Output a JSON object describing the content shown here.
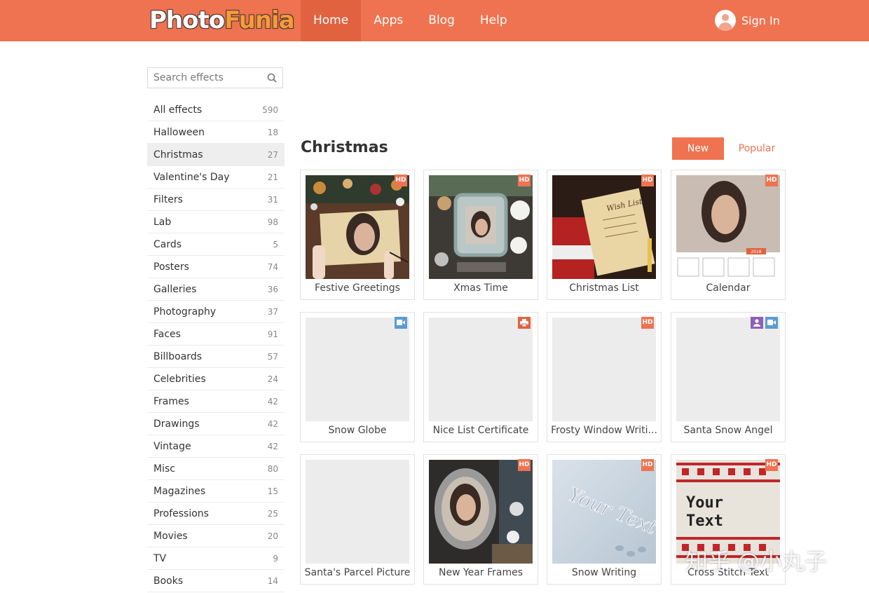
{
  "header": {
    "logo_part1": "Photo",
    "logo_part2": "Funia",
    "nav": [
      "Home",
      "Apps",
      "Blog",
      "Help"
    ],
    "active_nav": "Home",
    "sign_in": "Sign In"
  },
  "sidebar": {
    "search_placeholder": "Search effects",
    "categories": [
      {
        "label": "All effects",
        "count": "590"
      },
      {
        "label": "Halloween",
        "count": "18"
      },
      {
        "label": "Christmas",
        "count": "27"
      },
      {
        "label": "Valentine's Day",
        "count": "21"
      },
      {
        "label": "Filters",
        "count": "31"
      },
      {
        "label": "Lab",
        "count": "98"
      },
      {
        "label": "Cards",
        "count": "5"
      },
      {
        "label": "Posters",
        "count": "74"
      },
      {
        "label": "Galleries",
        "count": "36"
      },
      {
        "label": "Photography",
        "count": "37"
      },
      {
        "label": "Faces",
        "count": "91"
      },
      {
        "label": "Billboards",
        "count": "57"
      },
      {
        "label": "Celebrities",
        "count": "24"
      },
      {
        "label": "Frames",
        "count": "42"
      },
      {
        "label": "Drawings",
        "count": "42"
      },
      {
        "label": "Vintage",
        "count": "42"
      },
      {
        "label": "Misc",
        "count": "80"
      },
      {
        "label": "Magazines",
        "count": "15"
      },
      {
        "label": "Professions",
        "count": "25"
      },
      {
        "label": "Movies",
        "count": "20"
      },
      {
        "label": "TV",
        "count": "9"
      },
      {
        "label": "Books",
        "count": "14"
      }
    ],
    "active_category": "Christmas"
  },
  "main": {
    "title": "Christmas",
    "sort_new": "New",
    "sort_popular": "Popular",
    "effects": [
      {
        "label": "Festive Greetings",
        "badges": [
          "HD"
        ],
        "thumb": "festive-greetings"
      },
      {
        "label": "Xmas Time",
        "badges": [
          "HD"
        ],
        "thumb": "xmas-time"
      },
      {
        "label": "Christmas List",
        "badges": [
          "HD"
        ],
        "thumb": "christmas-list"
      },
      {
        "label": "Calendar",
        "badges": [
          "HD"
        ],
        "thumb": "calendar"
      },
      {
        "label": "Snow Globe",
        "badges": [
          "video"
        ],
        "thumb": "blank"
      },
      {
        "label": "Nice List Certificate",
        "badges": [
          "print"
        ],
        "thumb": "blank"
      },
      {
        "label": "Frosty Window Writi...",
        "badges": [
          "HD"
        ],
        "thumb": "blank"
      },
      {
        "label": "Santa Snow Angel",
        "badges": [
          "person",
          "video"
        ],
        "thumb": "blank"
      },
      {
        "label": "Santa's Parcel Picture",
        "badges": [],
        "thumb": "blank"
      },
      {
        "label": "New Year Frames",
        "badges": [
          "HD"
        ],
        "thumb": "new-year-frames"
      },
      {
        "label": "Snow Writing",
        "badges": [
          "HD"
        ],
        "thumb": "snow-writing"
      },
      {
        "label": "Cross Stitch Text",
        "badges": [
          "HD"
        ],
        "thumb": "cross-stitch"
      }
    ],
    "thumb_texts": {
      "wish_list": "Wish List",
      "calendar_year": "2018",
      "snow_text": "Your Text",
      "stitch_line1": "Your",
      "stitch_line2": "Text"
    }
  },
  "watermark": "知乎 @小丸子"
}
